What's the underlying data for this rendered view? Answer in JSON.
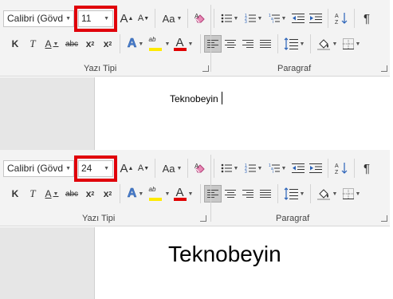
{
  "panels": [
    {
      "font_name": "Calibri (Gövd",
      "font_size": "11",
      "font_group_label": "Yazı Tipi",
      "paragraph_group_label": "Paragraf",
      "document_text": "Teknobeyin"
    },
    {
      "font_name": "Calibri (Gövd",
      "font_size": "24",
      "font_group_label": "Yazı Tipi",
      "paragraph_group_label": "Paragraf",
      "document_text": "Teknobeyin"
    }
  ],
  "buttons": {
    "grow_font": "A",
    "shrink_font": "A",
    "change_case": "Aa",
    "bold": "K",
    "italic": "T",
    "underline": "A",
    "strikethrough": "abc",
    "subscript": "x",
    "subscript_mark": "2",
    "superscript": "x",
    "superscript_mark": "2",
    "text_effects": "A",
    "highlight_letters": "ab",
    "font_color": "A",
    "pilcrow": "¶"
  },
  "colors": {
    "highlight_box": "#e0000a",
    "highlight_yellow": "#ffea00",
    "font_color_red": "#e00000",
    "ribbon_bg": "#f3f3f3"
  },
  "icons": [
    "eraser-icon",
    "bullets-icon",
    "numbering-icon",
    "multilevel-list-icon",
    "decrease-indent-icon",
    "increase-indent-icon",
    "sort-icon",
    "line-spacing-icon",
    "shading-icon",
    "borders-icon",
    "dialog-launcher-icon"
  ]
}
